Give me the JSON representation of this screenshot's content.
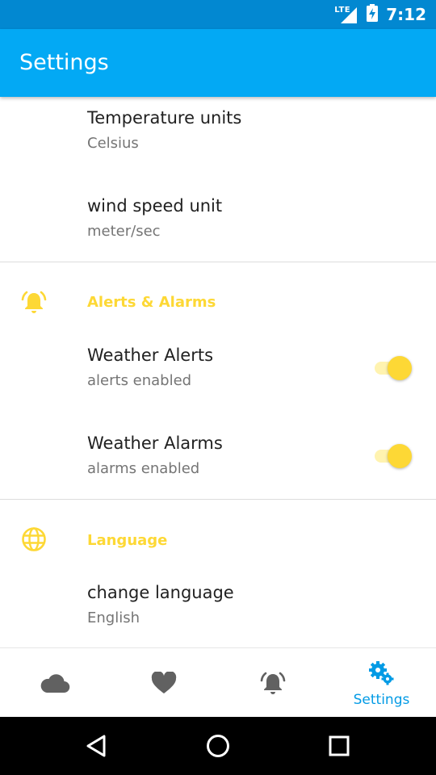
{
  "status_bar": {
    "network": "LTE",
    "time": "7:12"
  },
  "app_bar": {
    "title": "Settings"
  },
  "settings": {
    "units": {
      "temperature": {
        "title": "Temperature units",
        "summary": "Celsius"
      },
      "wind": {
        "title": "wind speed unit",
        "summary": "meter/sec"
      }
    },
    "alerts": {
      "category": "Alerts & Alarms",
      "category_icon": "bell-alarm-icon",
      "weather_alerts": {
        "title": "Weather Alerts",
        "summary": "alerts enabled",
        "enabled": true
      },
      "weather_alarms": {
        "title": "Weather Alarms",
        "summary": "alarms enabled",
        "enabled": true
      }
    },
    "language": {
      "category": "Language",
      "category_icon": "globe-icon",
      "change_language": {
        "title": "change language",
        "summary": "English"
      }
    }
  },
  "bottom_nav": {
    "items": [
      {
        "icon": "cloud-icon",
        "label": "",
        "active": false
      },
      {
        "icon": "heart-icon",
        "label": "",
        "active": false
      },
      {
        "icon": "bell-alarm-icon",
        "label": "",
        "active": false
      },
      {
        "icon": "settings-gears-icon",
        "label": "Settings",
        "active": true
      }
    ]
  },
  "system_nav": {
    "buttons": [
      "back-icon",
      "home-icon",
      "recents-icon"
    ]
  },
  "colors": {
    "status_bar": "#0288D1",
    "app_bar": "#03A9F4",
    "accent": "#FDD835",
    "active_nav": "#039BE5"
  }
}
